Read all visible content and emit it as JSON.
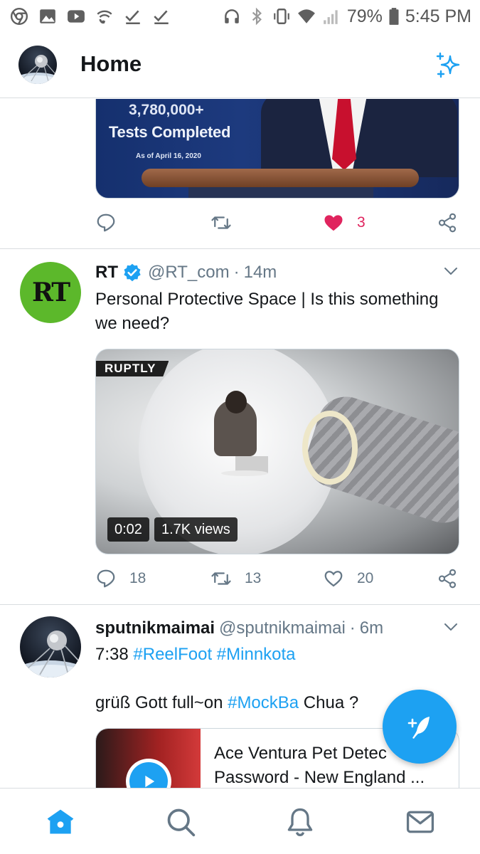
{
  "status_bar": {
    "battery": "79%",
    "time": "5:45 PM",
    "left_icons": [
      "chrome-icon",
      "gallery-icon",
      "youtube-icon",
      "wifi-call-icon",
      "check-icon",
      "check-icon"
    ],
    "right_icons": [
      "headset-icon",
      "bluetooth-icon",
      "vibrate-icon",
      "wifi-icon",
      "signal-icon",
      "battery-icon"
    ]
  },
  "header": {
    "title": "Home",
    "sparkle_icon": "sparkle-icon",
    "accent": "#1da1f2"
  },
  "top_tweet": {
    "media_text": {
      "line1": "3,780,000+",
      "line2": "Tests Completed",
      "line3": "As of April 16, 2020"
    },
    "actions": {
      "replies": "",
      "retweets": "",
      "likes": "3",
      "liked": true
    }
  },
  "tweets": [
    {
      "name": "RT",
      "verified": true,
      "handle": "@RT_com",
      "dot": "·",
      "time": "14m",
      "avatar_text": "RT",
      "text": "Personal Protective Space | Is this something we need?",
      "video": {
        "source_logo": "RUPTLY",
        "duration": "0:02",
        "views": "1.7K views"
      },
      "actions": {
        "replies": "18",
        "retweets": "13",
        "likes": "20"
      }
    },
    {
      "name": "sputnikmaimai",
      "handle": "@sputnikmaimai",
      "dot": "·",
      "time": "6m",
      "line1_prefix": "7:38 ",
      "line1_tag1": "#ReelFoot",
      "line1_space": " ",
      "line1_tag2": "#Minnkota",
      "line2_prefix": "grüß Gott full~on ",
      "line2_tag": "#MockBa",
      "line2_suffix": " Chua ?",
      "card": {
        "title_line1": "Ace Ventura Pet Detec",
        "title_line2": "Password - New England ..."
      }
    }
  ],
  "bottom_nav": [
    "home-icon",
    "search-icon",
    "notifications-icon",
    "messages-icon"
  ],
  "colors": {
    "like_red": "#e0245e",
    "text_secondary": "#657786",
    "rt_green": "#5cb82b"
  }
}
